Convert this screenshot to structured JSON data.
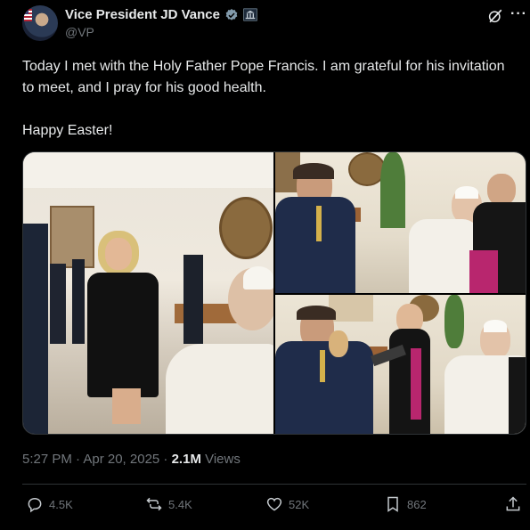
{
  "author": {
    "display_name": "Vice President JD Vance",
    "handle": "@VP"
  },
  "icons": {
    "verified": "verified-badge-icon",
    "government": "government-building-icon",
    "grok": "grok-icon",
    "more": "more-options-icon",
    "reply": "reply-icon",
    "repost": "repost-icon",
    "like": "like-icon",
    "views": "views-icon",
    "share": "share-icon"
  },
  "tweet": {
    "text_line1": "Today I met with the Holy Father Pope Francis. I am grateful for his invitation to meet, and I pray for his good health.",
    "text_line2": "Happy Easter!"
  },
  "meta": {
    "timestamp": "5:27 PM · Apr 20, 2025 · ",
    "views_count": "2.1M",
    "views_label": " Views"
  },
  "actions": {
    "replies": "4.5K",
    "reposts": "5.4K",
    "likes": "52K",
    "bookmarks": "862"
  },
  "colors": {
    "background": "#000000",
    "text": "#e7e9ea",
    "muted": "#71767b",
    "verified": "#829aab",
    "border": "#2f3336"
  }
}
